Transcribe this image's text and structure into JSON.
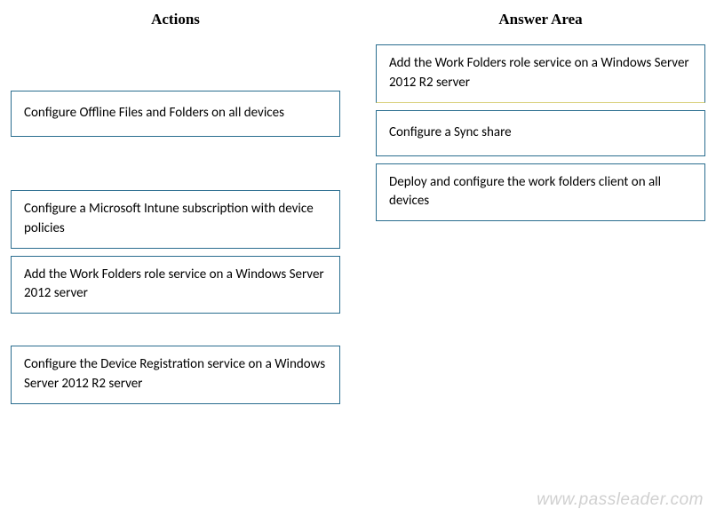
{
  "headers": {
    "actions": "Actions",
    "answer": "Answer Area"
  },
  "actions_items": [
    "Configure Offline Files and Folders on all devices",
    "Configure a Microsoft Intune subscription with device policies",
    "Add the Work Folders role service on a Windows Server 2012 server",
    "Configure the Device Registration service on a Windows Server 2012 R2 server"
  ],
  "answer_items": [
    "Add the Work Folders role service on a Windows Server 2012 R2 server",
    "Configure a Sync share",
    "Deploy and configure the work folders client on all devices"
  ],
  "watermark": "www.passleader.com"
}
